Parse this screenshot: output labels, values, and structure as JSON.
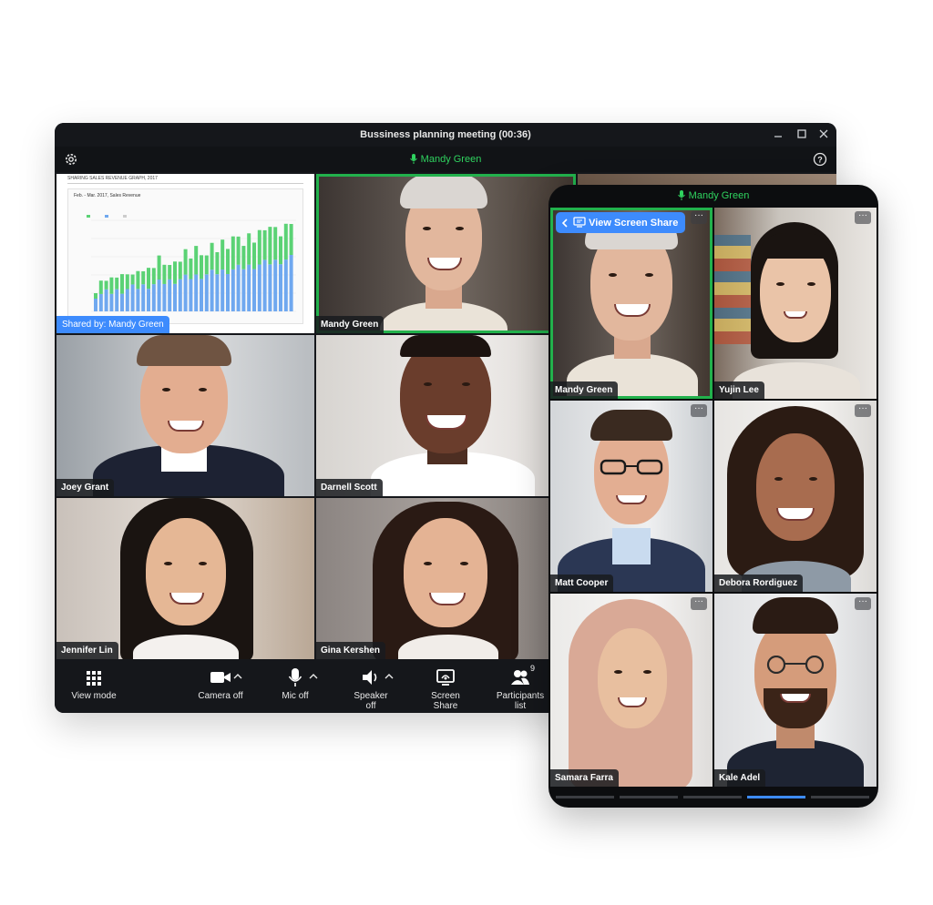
{
  "desktop": {
    "window_title": "Bussiness planning meeting (00:36)",
    "active_speaker": "Mandy Green",
    "shared_by": "Shared by: Mandy Green",
    "shared_doc": {
      "title": "SHARING SALES REVENUE GRAPH, 2017",
      "subtitle": "Feb. - Mar. 2017, Sales Revenue"
    },
    "tiles": [
      {
        "name": "Mandy Green"
      },
      {
        "name": "Joey Grant"
      },
      {
        "name": "Darnell Scott"
      },
      {
        "name": "Jennifer Lin"
      },
      {
        "name": "Gina Kershen"
      }
    ],
    "toolbar": {
      "view_mode": "View mode",
      "camera": "Camera off",
      "mic": "Mic off",
      "speaker": "Speaker off",
      "screen_share": "Screen Share",
      "participants": "Participants list",
      "participants_count": "9"
    },
    "icons": [
      "gear-icon",
      "help-icon",
      "minimize-icon",
      "maximize-icon",
      "close-icon",
      "mic-icon",
      "grid-icon",
      "camera-icon",
      "speaker-icon",
      "screen-share-icon",
      "participants-icon"
    ]
  },
  "mobile": {
    "active_speaker": "Mandy Green",
    "view_screen_share": "View Screen Share",
    "tiles": [
      {
        "name": "Mandy Green"
      },
      {
        "name": "Yujin Lee"
      },
      {
        "name": "Matt Cooper"
      },
      {
        "name": "Debora Rordiguez"
      },
      {
        "name": "Samara Farra"
      },
      {
        "name": "Kale Adel"
      }
    ]
  },
  "colors": {
    "accent_green": "#22b14c",
    "speaker_green": "#2fd35f",
    "share_blue": "#3d8bfd",
    "window_bg": "#15171b"
  }
}
